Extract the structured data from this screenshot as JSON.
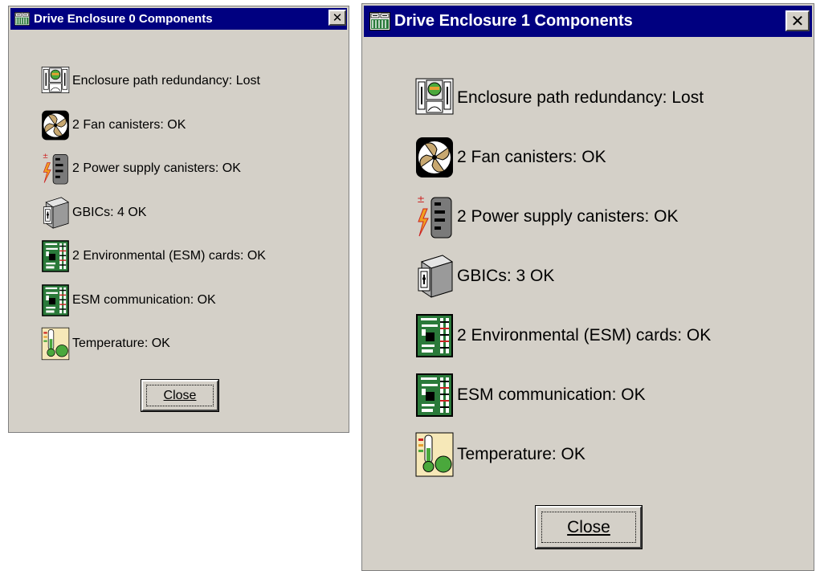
{
  "icons": {
    "enclosure": "enclosure-path-icon",
    "fan": "fan-icon",
    "power": "power-supply-icon",
    "gbic": "gbic-icon",
    "esm": "esm-card-icon",
    "temperature": "thermometer-icon",
    "title": "enclosure-grid-icon"
  },
  "colors": {
    "title_bar": "#000080",
    "window_face": "#d4d0c8",
    "esm_green": "#2a7a3a",
    "fan_blade": "#c8a870",
    "temp_green": "#4aa83c"
  },
  "windows": [
    {
      "title": "Drive Enclosure 0 Components",
      "close_x_label": "✕",
      "items": [
        {
          "label": "Enclosure path redundancy: Lost"
        },
        {
          "label": "2 Fan canisters: OK"
        },
        {
          "label": "2 Power supply canisters: OK"
        },
        {
          "label": "GBICs: 4 OK"
        },
        {
          "label": "2 Environmental (ESM) cards: OK"
        },
        {
          "label": "ESM communication: OK"
        },
        {
          "label": "Temperature: OK"
        }
      ],
      "close_button_label": "Close"
    },
    {
      "title": "Drive Enclosure 1 Components",
      "close_x_label": "✕",
      "items": [
        {
          "label": "Enclosure path redundancy: Lost"
        },
        {
          "label": "2 Fan canisters: OK"
        },
        {
          "label": "2 Power supply canisters: OK"
        },
        {
          "label": "GBICs: 3 OK"
        },
        {
          "label": "2 Environmental (ESM) cards: OK"
        },
        {
          "label": "ESM communication: OK"
        },
        {
          "label": "Temperature: OK"
        }
      ],
      "close_button_label": "Close"
    }
  ]
}
